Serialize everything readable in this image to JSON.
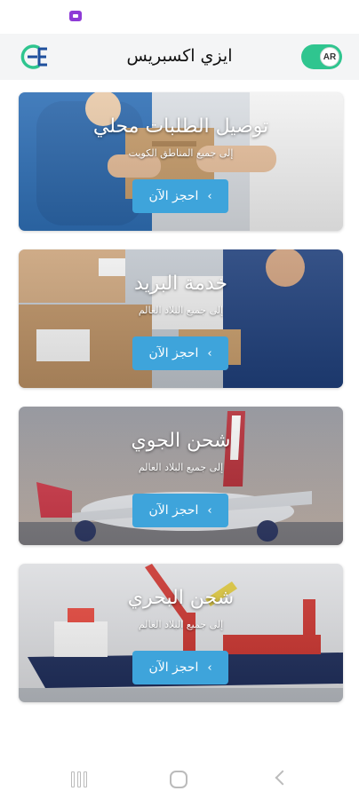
{
  "header": {
    "title": "ايزي اكسبريس",
    "lang_label": "AR",
    "logo_icon": "easy-express-logo-icon"
  },
  "cards": [
    {
      "title": "توصيل الطلبات محلي",
      "subtitle": "إلى جميع المناطق الكويت",
      "button_label": "احجز الآن",
      "button_icon": "chevron-left-icon"
    },
    {
      "title": "خدمة البريد",
      "subtitle": "إلى جميع البلاد العالم",
      "button_label": "احجز الآن",
      "button_icon": "chevron-left-icon"
    },
    {
      "title": "شحن الجوي",
      "subtitle": "إلى جميع البلاد العالم",
      "button_label": "احجز الآن",
      "button_icon": "chevron-left-icon"
    },
    {
      "title": "شحن البحري",
      "subtitle": "إلى جميع البلاد العالم",
      "button_label": "احجز الآن",
      "button_icon": "chevron-left-icon"
    }
  ],
  "colors": {
    "accent_button": "#3ea4db",
    "toggle": "#2fc58f",
    "header_bg": "#f4f5f6"
  }
}
